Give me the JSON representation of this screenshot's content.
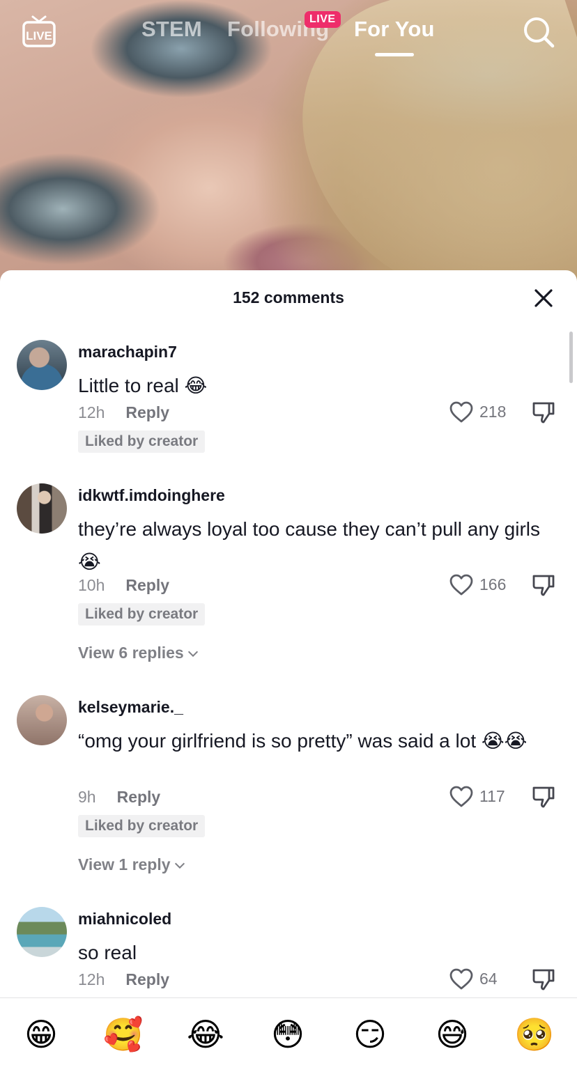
{
  "top_nav": {
    "live_icon_label": "LIVE",
    "tabs": [
      {
        "label": "STEM"
      },
      {
        "label": "Following",
        "badge": "LIVE"
      },
      {
        "label": "For You",
        "active": true
      }
    ]
  },
  "comments_sheet": {
    "title": "152 comments",
    "comments": [
      {
        "username": "marachapin7",
        "text": "Little to real 😂",
        "time": "12h",
        "reply_label": "Reply",
        "likes": "218",
        "badge": "Liked by creator"
      },
      {
        "username": "idkwtf.imdoinghere",
        "text": "they’re always loyal too cause they can’t pull any girls😭",
        "time": "10h",
        "reply_label": "Reply",
        "likes": "166",
        "badge": "Liked by creator",
        "view_replies": "View 6 replies"
      },
      {
        "username": "kelseymarie._",
        "text": "“omg your girlfriend is so pretty” was said a lot 😭😭",
        "time": "9h",
        "reply_label": "Reply",
        "likes": "117",
        "badge": "Liked by creator",
        "view_replies": "View 1 reply"
      },
      {
        "username": "miahnicoled",
        "text": "so real",
        "time": "12h",
        "reply_label": "Reply",
        "likes": "64"
      }
    ]
  },
  "emoji_bar": [
    "😁",
    "🥰",
    "😂",
    "😳",
    "😏",
    "😅",
    "🥺"
  ],
  "colors": {
    "live_badge": "#ee2d6a",
    "text_primary": "#161823",
    "badge_bg": "#f1f1f2"
  }
}
